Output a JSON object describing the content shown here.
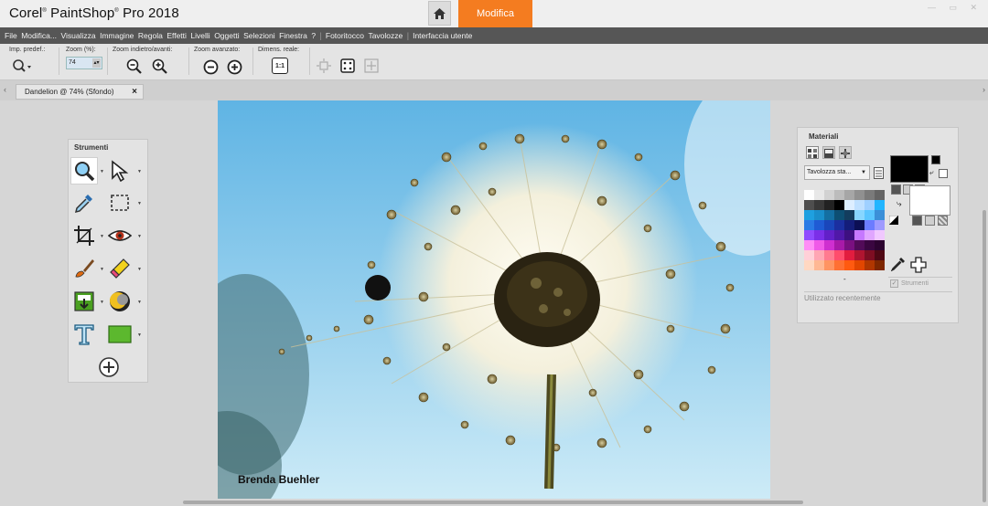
{
  "titlebar": {
    "brand": "Corel",
    "product": "PaintShop",
    "version": "Pro 2018",
    "home_icon": "home-icon",
    "workspace_tab": "Modifica",
    "accent_color": "#f47c20"
  },
  "menu": {
    "items": [
      "File",
      "Modifica...",
      "Visualizza",
      "Immagine",
      "Regola",
      "Effetti",
      "Livelli",
      "Oggetti",
      "Selezioni",
      "Finestra",
      "?"
    ],
    "extra": [
      "Fotoritocco",
      "Tavolozze",
      "Interfaccia utente"
    ]
  },
  "options": {
    "preset_label": "Imp. predef.:",
    "zoom_label": "Zoom (%):",
    "zoom_value": "74",
    "zoom_nav_label": "Zoom indietro/avanti:",
    "zoom_adv_label": "Zoom avanzato:",
    "actual_size_label": "Dimens. reale:",
    "actual_size_btn": "1:1"
  },
  "document": {
    "tab_label": "Dandelion @  74% (Sfondo)",
    "close": "×",
    "photo_credit": "Brenda Buehler"
  },
  "tools": {
    "title": "Strumenti",
    "items": [
      "zoom-icon",
      "pick-arrow-icon",
      "dropper-icon",
      "selection-icon",
      "crop-icon",
      "red-eye-icon",
      "paintbrush-icon",
      "eraser-icon",
      "fill-icon",
      "dodge-icon",
      "text-icon",
      "rectangle-icon",
      "add-tool-icon"
    ]
  },
  "materials": {
    "title": "Materiali",
    "palette_select": "Tavolozza sta...",
    "strumenti_checkbox": "Strumenti",
    "recent_label": "Utilizzato recentemente",
    "foreground": "#000000",
    "background": "#ffffff",
    "swatches": [
      "#ffffff",
      "#e8e8e8",
      "#d2d2d2",
      "#bcbcbc",
      "#a6a6a6",
      "#909090",
      "#7a7a7a",
      "#646464",
      "#4e4e4e",
      "#383838",
      "#222222",
      "#000000",
      "#ddeeff",
      "#bfe0ff",
      "#9fd0ff",
      "#22b5ff",
      "#1ea0e0",
      "#1a8ecb",
      "#146fa2",
      "#0d4f73",
      "#133d5e",
      "#87d6ff",
      "#5ac5ff",
      "#3b8fd8",
      "#2a7ae5",
      "#1f5bd4",
      "#1a46bb",
      "#1b2fa0",
      "#141d7a",
      "#0c0f55",
      "#6c7cff",
      "#9f9bff",
      "#8f4bff",
      "#7b2fe8",
      "#6220c8",
      "#5018a8",
      "#3d1080",
      "#c678ff",
      "#e0a6ff",
      "#f0c8ff",
      "#ff8ef6",
      "#f05ae8",
      "#cf2fd0",
      "#a81aa8",
      "#7a1080",
      "#520b58",
      "#3a0640",
      "#2c0330",
      "#ffd0d8",
      "#ffa6b4",
      "#ff7a90",
      "#ff4d6c",
      "#e21d3f",
      "#b01530",
      "#7e0e22",
      "#4f0814",
      "#ffd8c2",
      "#ffb894",
      "#ff9462",
      "#ff7033",
      "#ff5a10",
      "#e24600",
      "#b03600",
      "#7e2600"
    ]
  }
}
